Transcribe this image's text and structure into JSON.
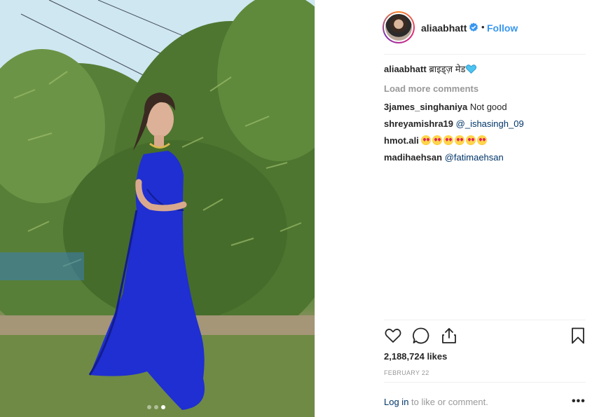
{
  "post": {
    "username": "aliaabhatt",
    "follow_label": "Follow",
    "separator": "•",
    "caption": {
      "username": "aliaabhatt",
      "text": "ब्राइड्ज़ मेड",
      "emoji": "blue-heart"
    },
    "load_more_label": "Load more comments",
    "comments": [
      {
        "username": "3james_singhaniya",
        "text": "Not good",
        "mention": ""
      },
      {
        "username": "shreyamishra19",
        "text": "",
        "mention": "@_ishasingh_09"
      },
      {
        "username": "hmot.ali",
        "text": "",
        "mention": "",
        "emoji_count": 6,
        "emoji": "star-struck"
      },
      {
        "username": "madihaehsan",
        "text": "",
        "mention": "@fatimaehsan"
      }
    ],
    "likes": "2,188,724 likes",
    "date": "FEBRUARY 22",
    "login_link": "Log in",
    "login_text": " to like or comment.",
    "more_label": "•••"
  },
  "carousel": {
    "count": 3,
    "active_index": 2
  },
  "icons": {
    "like": "heart-icon",
    "comment": "comment-icon",
    "share": "share-icon",
    "save": "bookmark-icon",
    "verified": "verified-badge-icon"
  },
  "colors": {
    "accent": "#3897f0",
    "link": "#003569",
    "muted": "#999999",
    "text": "#262626",
    "saree": "#1f2fd1"
  }
}
